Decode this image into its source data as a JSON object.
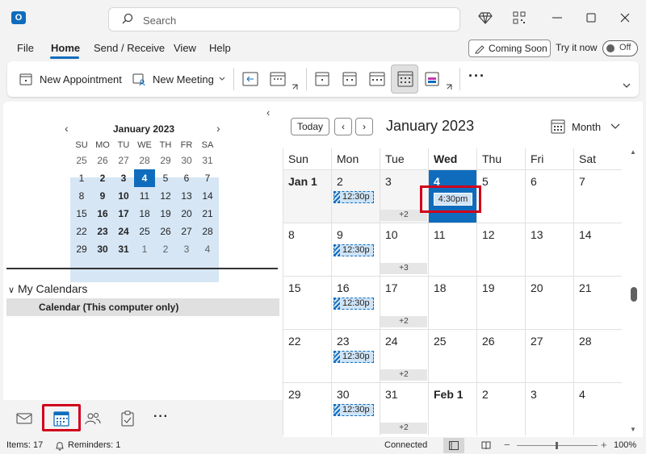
{
  "app": {
    "logo_letter": "O"
  },
  "search": {
    "placeholder": "Search"
  },
  "menu": {
    "items": [
      "File",
      "Home",
      "Send / Receive",
      "View",
      "Help"
    ],
    "active": "Home",
    "coming_soon": "Coming Soon",
    "try_it_now": "Try it now",
    "toggle_state": "Off"
  },
  "ribbon": {
    "new_appointment": "New Appointment",
    "new_meeting": "New Meeting",
    "more": "···"
  },
  "mini_calendar": {
    "title": "January 2023",
    "dow": [
      "SU",
      "MO",
      "TU",
      "WE",
      "TH",
      "FR",
      "SA"
    ],
    "weeks": [
      [
        "25",
        "26",
        "27",
        "28",
        "29",
        "30",
        "31"
      ],
      [
        "1",
        "2",
        "3",
        "4",
        "5",
        "6",
        "7"
      ],
      [
        "8",
        "9",
        "10",
        "11",
        "12",
        "13",
        "14"
      ],
      [
        "15",
        "16",
        "17",
        "18",
        "19",
        "20",
        "21"
      ],
      [
        "22",
        "23",
        "24",
        "25",
        "26",
        "27",
        "28"
      ],
      [
        "29",
        "30",
        "31",
        "1",
        "2",
        "3",
        "4"
      ]
    ],
    "today": "4"
  },
  "my_calendars": {
    "header": "My Calendars",
    "items": [
      "Calendar (This computer only)"
    ]
  },
  "main": {
    "today_btn": "Today",
    "prev": "‹",
    "next": "›",
    "title": "January 2023",
    "view_label": "Month",
    "weekdays": [
      "Sun",
      "Mon",
      "Tue",
      "Wed",
      "Thu",
      "Fri",
      "Sat"
    ],
    "weeks": [
      [
        "Jan 1",
        "2",
        "3",
        "4",
        "5",
        "6",
        "7"
      ],
      [
        "8",
        "9",
        "10",
        "11",
        "12",
        "13",
        "14"
      ],
      [
        "15",
        "16",
        "17",
        "18",
        "19",
        "20",
        "21"
      ],
      [
        "22",
        "23",
        "24",
        "25",
        "26",
        "27",
        "28"
      ],
      [
        "29",
        "30",
        "31",
        "Feb 1",
        "2",
        "3",
        "4"
      ]
    ],
    "event_time": "12:30p",
    "today_event": "4:30pm",
    "more_counts": [
      "+2",
      "+3",
      "+2",
      "+2",
      "+2"
    ]
  },
  "status": {
    "items": "Items: 17",
    "reminders": "Reminders: 1",
    "connection": "Connected",
    "zoom": "100%"
  }
}
